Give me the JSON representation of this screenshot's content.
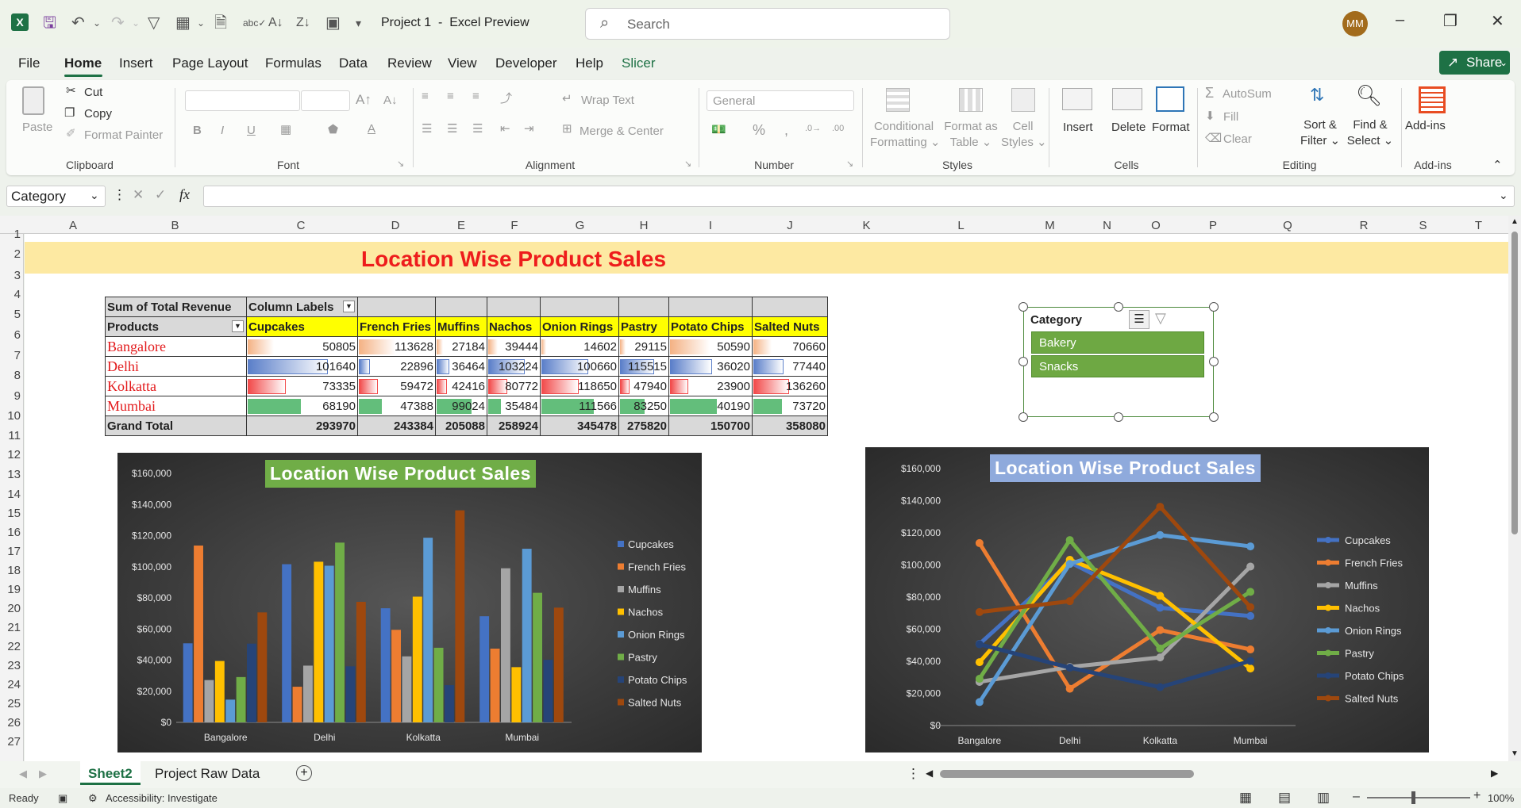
{
  "app": {
    "doc_title": "Project 1  -  Excel Preview",
    "search_placeholder": "Search",
    "avatar": "MM"
  },
  "menu": [
    "File",
    "Home",
    "Insert",
    "Page Layout",
    "Formulas",
    "Data",
    "Review",
    "View",
    "Developer",
    "Help",
    "Slicer"
  ],
  "share": "Share",
  "ribbon": {
    "paste": "Paste",
    "cut": "Cut",
    "copy": "Copy",
    "format_painter": "Format Painter",
    "clipboard": "Clipboard",
    "font": "Font",
    "wrap_text": "Wrap Text",
    "merge_center": "Merge & Center",
    "alignment": "Alignment",
    "number_format": "General",
    "number": "Number",
    "conditional": "Conditional",
    "formatting": "Formatting",
    "format_as": "Format as",
    "table": "Table",
    "cell": "Cell",
    "styles_l": "Styles",
    "styles": "Styles",
    "insert": "Insert",
    "delete": "Delete",
    "format": "Format",
    "cells": "Cells",
    "autosum": "AutoSum",
    "fill": "Fill",
    "clear": "Clear",
    "sort": "Sort &",
    "filter": "Filter",
    "find": "Find &",
    "select": "Select",
    "editing": "Editing",
    "addins": "Add-ins",
    "addins_group": "Add-ins"
  },
  "namebox": "Category",
  "columns": [
    "A",
    "B",
    "C",
    "D",
    "E",
    "F",
    "G",
    "H",
    "I",
    "J",
    "K",
    "L",
    "M",
    "N",
    "O",
    "P",
    "Q",
    "R",
    "S",
    "T"
  ],
  "rows": [
    "1",
    "2",
    "3",
    "4",
    "5",
    "6",
    "7",
    "8",
    "9",
    "10",
    "11",
    "12",
    "13",
    "14",
    "15",
    "16",
    "17",
    "18",
    "19",
    "20",
    "21",
    "22",
    "23",
    "24",
    "25",
    "26",
    "27"
  ],
  "banner": "Location Wise Product Sales",
  "pivot": {
    "corner": "Sum of Total Revenue",
    "col_labels": "Column Labels",
    "row_header": "Products",
    "products": [
      "Cupcakes",
      "French Fries",
      "Muffins",
      "Nachos",
      "Onion Rings",
      "Pastry",
      "Potato Chips",
      "Salted Nuts"
    ],
    "rows": [
      {
        "name": "Bangalore",
        "values": [
          50805,
          113628,
          27184,
          39444,
          14602,
          29115,
          50590,
          70660
        ]
      },
      {
        "name": "Delhi",
        "values": [
          101640,
          22896,
          36464,
          103224,
          100660,
          115515,
          36020,
          77440
        ]
      },
      {
        "name": "Kolkatta",
        "values": [
          73335,
          59472,
          42416,
          80772,
          118650,
          47940,
          23900,
          136260
        ]
      },
      {
        "name": "Mumbai",
        "values": [
          68190,
          47388,
          99024,
          35484,
          111566,
          83250,
          40190,
          73720
        ]
      }
    ],
    "total_label": "Grand Total",
    "totals": [
      293970,
      243384,
      205088,
      258924,
      345478,
      275820,
      150700,
      358080
    ]
  },
  "slicer": {
    "title": "Category",
    "items": [
      "Bakery",
      "Snacks"
    ]
  },
  "chart_data": [
    {
      "type": "bar",
      "title": "Location Wise Product Sales",
      "categories": [
        "Bangalore",
        "Delhi",
        "Kolkatta",
        "Mumbai"
      ],
      "ylim": [
        0,
        160000
      ],
      "yticks": [
        "$0",
        "$20,000",
        "$40,000",
        "$60,000",
        "$80,000",
        "$100,000",
        "$120,000",
        "$140,000",
        "$160,000"
      ],
      "legend": "right",
      "series": [
        {
          "name": "Cupcakes",
          "color": "#4472c4",
          "values": [
            50805,
            101640,
            73335,
            68190
          ]
        },
        {
          "name": "French Fries",
          "color": "#ed7d31",
          "values": [
            113628,
            22896,
            59472,
            47388
          ]
        },
        {
          "name": "Muffins",
          "color": "#a5a5a5",
          "values": [
            27184,
            36464,
            42416,
            99024
          ]
        },
        {
          "name": "Nachos",
          "color": "#ffc000",
          "values": [
            39444,
            103224,
            80772,
            35484
          ]
        },
        {
          "name": "Onion Rings",
          "color": "#5b9bd5",
          "values": [
            14602,
            100660,
            118650,
            111566
          ]
        },
        {
          "name": "Pastry",
          "color": "#70ad47",
          "values": [
            29115,
            115515,
            47940,
            83250
          ]
        },
        {
          "name": "Potato Chips",
          "color": "#264478",
          "values": [
            50590,
            36020,
            23900,
            40190
          ]
        },
        {
          "name": "Salted Nuts",
          "color": "#9e480e",
          "values": [
            70660,
            77440,
            136260,
            73720
          ]
        }
      ]
    },
    {
      "type": "line",
      "title": "Location Wise Product Sales",
      "categories": [
        "Bangalore",
        "Delhi",
        "Kolkatta",
        "Mumbai"
      ],
      "ylim": [
        0,
        160000
      ],
      "yticks": [
        "$0",
        "$20,000",
        "$40,000",
        "$60,000",
        "$80,000",
        "$100,000",
        "$120,000",
        "$140,000",
        "$160,000"
      ],
      "legend": "right",
      "series": [
        {
          "name": "Cupcakes",
          "color": "#4472c4",
          "values": [
            50805,
            101640,
            73335,
            68190
          ]
        },
        {
          "name": "French Fries",
          "color": "#ed7d31",
          "values": [
            113628,
            22896,
            59472,
            47388
          ]
        },
        {
          "name": "Muffins",
          "color": "#a5a5a5",
          "values": [
            27184,
            36464,
            42416,
            99024
          ]
        },
        {
          "name": "Nachos",
          "color": "#ffc000",
          "values": [
            39444,
            103224,
            80772,
            35484
          ]
        },
        {
          "name": "Onion Rings",
          "color": "#5b9bd5",
          "values": [
            14602,
            100660,
            118650,
            111566
          ]
        },
        {
          "name": "Pastry",
          "color": "#70ad47",
          "values": [
            29115,
            115515,
            47940,
            83250
          ]
        },
        {
          "name": "Potato Chips",
          "color": "#264478",
          "values": [
            50590,
            36020,
            23900,
            40190
          ]
        },
        {
          "name": "Salted Nuts",
          "color": "#9e480e",
          "values": [
            70660,
            77440,
            136260,
            73720
          ]
        }
      ]
    }
  ],
  "sheets": [
    "Sheet2",
    "Project Raw Data"
  ],
  "status": {
    "ready": "Ready",
    "accessibility": "Accessibility: Investigate",
    "zoom": "100%"
  },
  "colors": {
    "banner_bg": "#fde9a2",
    "banner_text": "#ee1c1c",
    "excel_green": "#1e7145",
    "slicer_item": "#6ea843"
  }
}
